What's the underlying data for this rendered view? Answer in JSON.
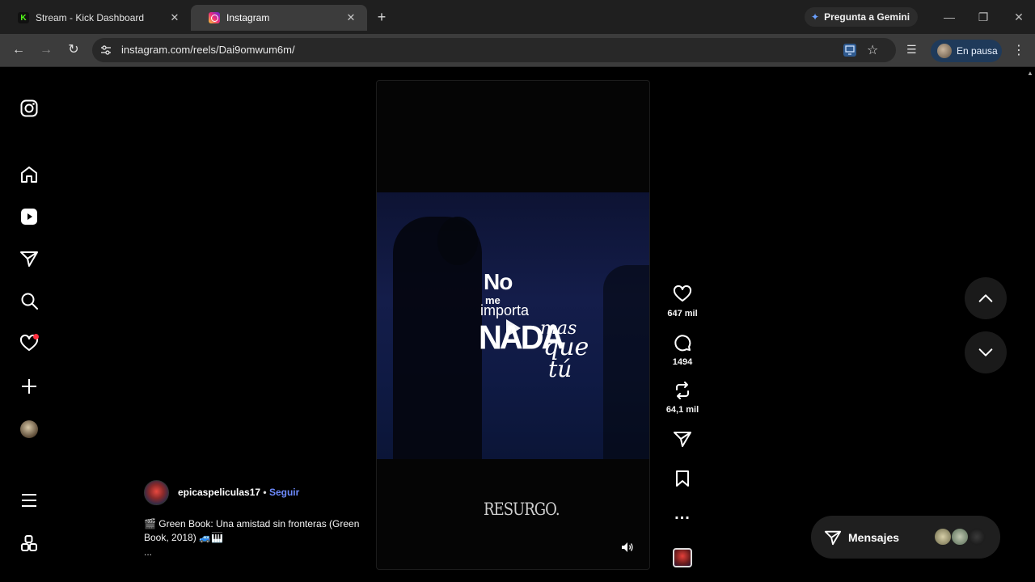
{
  "browser": {
    "tabs": [
      {
        "title": "Stream - Kick Dashboard",
        "favicon": "kick-logo-icon",
        "active": false
      },
      {
        "title": "Instagram",
        "favicon": "instagram-logo-icon",
        "active": true
      }
    ],
    "new_tab": "+",
    "gemini_label": "Pregunta a Gemini",
    "url": "instagram.com/reels/Dai9omwum6m/",
    "profile_label": "En pausa",
    "colors": {
      "tabbar": "#1f1f1f",
      "toolbar": "#3c3c3c",
      "profile_pill": "#1f3a5a"
    }
  },
  "sidebar": {
    "items": [
      {
        "name": "instagram-logo",
        "icon": "instagram-icon"
      },
      {
        "name": "home",
        "icon": "home-icon"
      },
      {
        "name": "reels",
        "icon": "reels-icon"
      },
      {
        "name": "messages",
        "icon": "send-icon"
      },
      {
        "name": "search",
        "icon": "search-icon"
      },
      {
        "name": "notifications",
        "icon": "heart-icon",
        "badge": true
      },
      {
        "name": "create",
        "icon": "plus-icon"
      },
      {
        "name": "profile",
        "icon": "avatar"
      },
      {
        "name": "more",
        "icon": "menu-icon"
      },
      {
        "name": "also-from-meta",
        "icon": "grid-icon"
      }
    ]
  },
  "reel": {
    "lyrics": {
      "line1": "No",
      "line2": "me",
      "line3": "importa",
      "line4": "NADA",
      "line5": "mas",
      "line6": "que",
      "line7": "tú"
    },
    "watermark": "RESURGO."
  },
  "actions": {
    "likes": "647 mil",
    "comments": "1494",
    "reposts": "64,1 mil",
    "more": "..."
  },
  "caption": {
    "username": "epicaspeliculas17",
    "separator": "•",
    "follow_label": "Seguir",
    "text": "🎬 Green Book: Una amistad sin fronteras (Green Book, 2018) 🚙🎹",
    "more": "..."
  },
  "messages": {
    "label": "Mensajes"
  }
}
